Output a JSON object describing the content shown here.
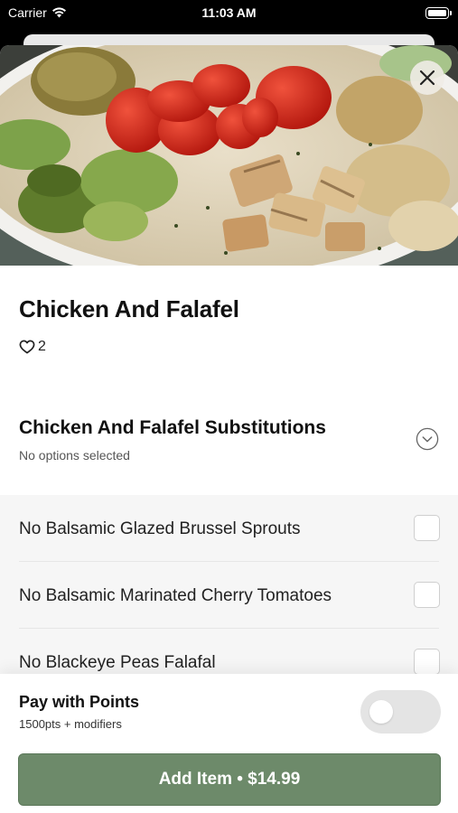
{
  "status_bar": {
    "carrier": "Carrier",
    "time": "11:03 AM"
  },
  "item": {
    "title": "Chicken And Falafel",
    "likes": "2"
  },
  "modifier_group": {
    "title": "Chicken And Falafel Substitutions",
    "subtitle": "No options selected",
    "options": [
      {
        "label": "No Balsamic Glazed Brussel Sprouts",
        "checked": false
      },
      {
        "label": "No Balsamic Marinated Cherry Tomatoes",
        "checked": false
      },
      {
        "label": "No Blackeye Peas Falafal",
        "checked": false
      }
    ]
  },
  "points": {
    "title": "Pay with Points",
    "subtitle": "1500pts + modifiers",
    "enabled": false
  },
  "add_button": {
    "label": "Add Item • $14.99"
  },
  "colors": {
    "accent": "#6d8a6a",
    "toggle_off": "#e4e4e4"
  },
  "icons": {
    "close": "close-icon",
    "heart": "heart-outline-icon",
    "chevron": "chevron-down-circle-icon",
    "wifi": "wifi-icon",
    "battery": "battery-icon"
  }
}
